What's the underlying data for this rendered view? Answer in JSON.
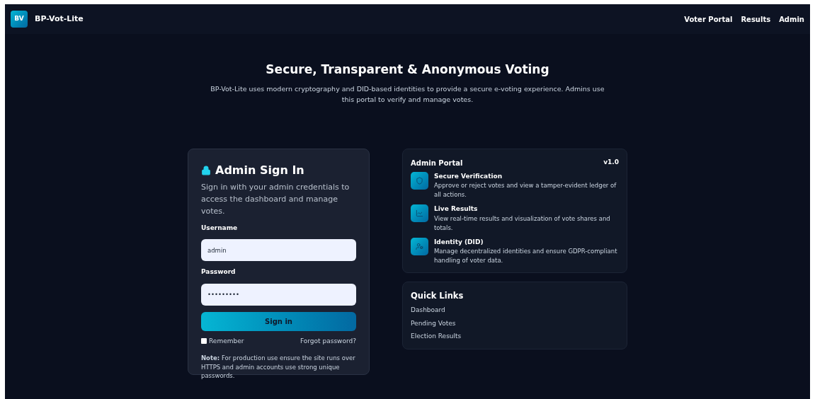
{
  "nav": {
    "logo_badge": "BV",
    "brand": "BP-Vot-Lite",
    "links": [
      "Voter Portal",
      "Results",
      "Admin"
    ]
  },
  "hero": {
    "title": "Secure, Transparent & Anonymous Voting",
    "subtitle": "BP-Vot-Lite uses modern cryptography and DID-based identities to provide a secure e-voting experience. Admins use this portal to verify and manage votes."
  },
  "sign_in": {
    "title": "Admin Sign In",
    "description": "Sign in with your admin credentials to access the dashboard and manage votes.",
    "fields": [
      {
        "label": "Username",
        "value": "admin"
      },
      {
        "label": "Password",
        "value": "•••••••••"
      }
    ],
    "button": "Sign in",
    "remember": {
      "label": "Remember",
      "checked": false
    },
    "forgot": "Forgot password?",
    "note": "**Note:** For production use ensure the site runs over HTTPS and admin accounts use strong unique passwords."
  },
  "portal": {
    "title": "Admin Portal",
    "version": "v1.0",
    "features": [
      {
        "title": "Secure Verification",
        "text": "Approve or reject votes and view a tamper-evident ledger of all actions."
      },
      {
        "title": "Live Results",
        "text": "View real-time results and visualization of vote shares and totals."
      },
      {
        "title": "Identity (DID)",
        "text": "Manage decentralized identities and ensure GDPR-compliant handling of voter data."
      }
    ]
  },
  "quick_links": {
    "title": "Quick Links",
    "links": [
      "Dashboard",
      "Pending Votes",
      "Election Results"
    ]
  }
}
